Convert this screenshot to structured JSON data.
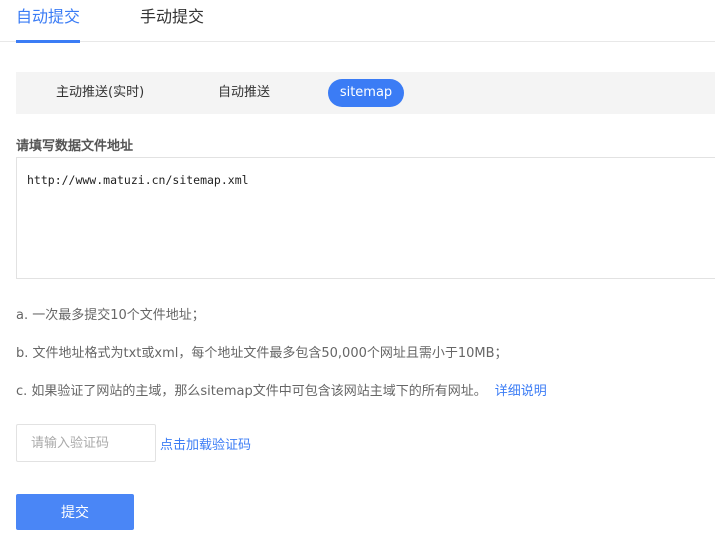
{
  "top_tabs": [
    {
      "label": "自动提交",
      "active": true
    },
    {
      "label": "手动提交",
      "active": false
    }
  ],
  "sub_tabs": [
    {
      "label": "主动推送(实时)",
      "active": false
    },
    {
      "label": "自动推送",
      "active": false
    },
    {
      "label": "sitemap",
      "active": true
    }
  ],
  "section_title": "请填写数据文件地址",
  "url_input": {
    "value": "http://www.matuzi.cn/sitemap.xml"
  },
  "notes": [
    {
      "text": "a. 一次最多提交10个文件地址；"
    },
    {
      "text": "b. 文件地址格式为txt或xml，每个地址文件最多包含50,000个网址且需小于10MB；"
    },
    {
      "text": "c. 如果验证了网站的主域，那么sitemap文件中可包含该网站主域下的所有网址。",
      "link": "详细说明"
    }
  ],
  "captcha": {
    "placeholder": "请输入验证码",
    "load_link": "点击加载验证码"
  },
  "submit_label": "提交",
  "colors": {
    "accent": "#3b7cf5",
    "button": "#4a86f6",
    "subbar_bg": "#f4f4f4"
  }
}
